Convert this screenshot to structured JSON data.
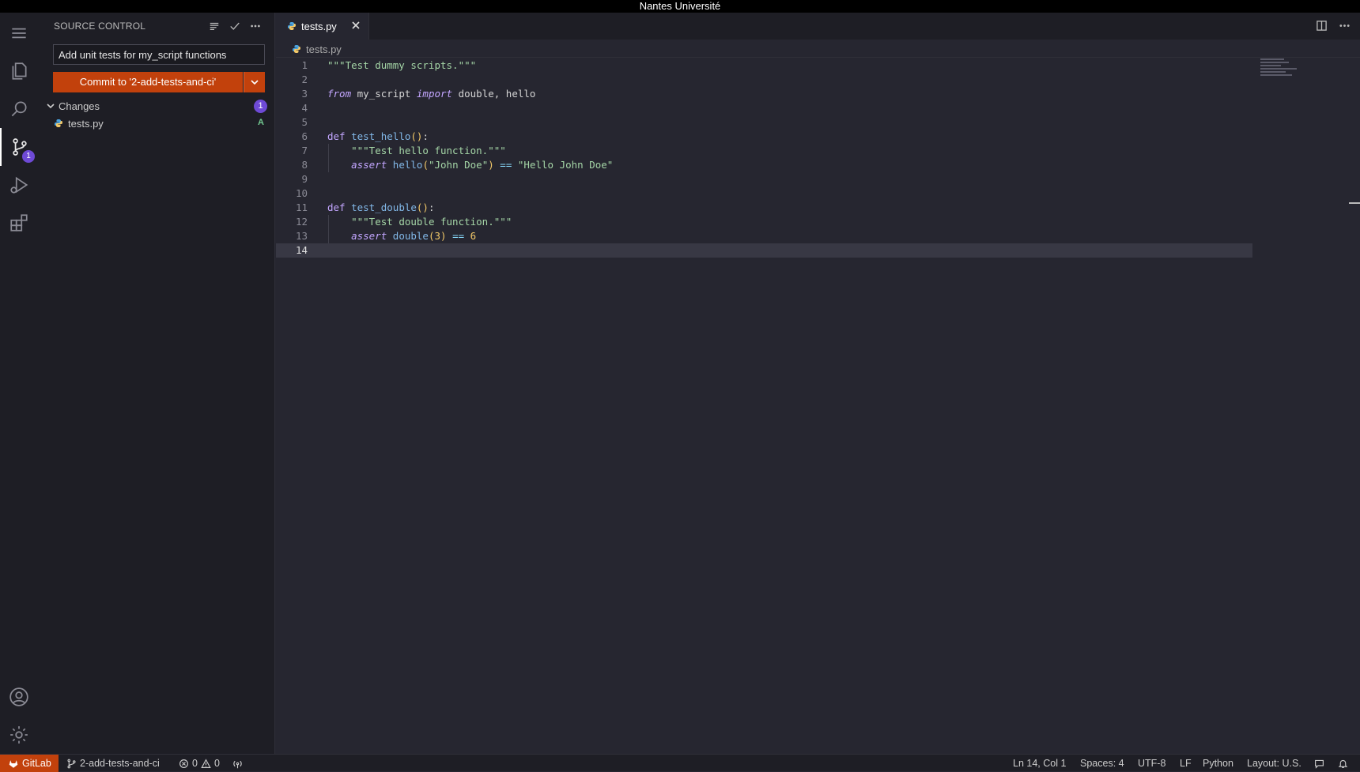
{
  "window": {
    "title": "Nantes Université"
  },
  "activity_bar": {
    "items": [
      {
        "name": "menu",
        "icon": "menu-icon"
      },
      {
        "name": "explorer",
        "icon": "files-icon"
      },
      {
        "name": "search",
        "icon": "search-icon"
      },
      {
        "name": "source-control",
        "icon": "source-control-icon",
        "badge": "1"
      },
      {
        "name": "run-debug",
        "icon": "run-debug-icon"
      },
      {
        "name": "extensions",
        "icon": "extensions-icon"
      },
      {
        "name": "accounts",
        "icon": "account-icon"
      },
      {
        "name": "manage",
        "icon": "gear-icon"
      }
    ]
  },
  "sidebar": {
    "title": "SOURCE CONTROL",
    "commit_message": "Add unit tests for my_script functions",
    "commit_label": "Commit to '2-add-tests-and-ci'",
    "changes_label": "Changes",
    "changes_count": "1",
    "files": [
      {
        "name": "tests.py",
        "status": "A"
      }
    ]
  },
  "editor": {
    "tab_label": "tests.py",
    "breadcrumb": "tests.py",
    "current_line": 14
  },
  "status_bar": {
    "gitlab": "GitLab",
    "branch": "2-add-tests-and-ci",
    "errors": "0",
    "warnings": "0",
    "position": "Ln 14, Col 1",
    "spaces": "Spaces: 4",
    "encoding": "UTF-8",
    "eol": "LF",
    "language": "Python",
    "layout": "Layout: U.S."
  },
  "colors": {
    "accent": "#c2410c",
    "badge": "#6e4ad6",
    "background": "#262630",
    "sidebar": "#1e1e25"
  }
}
